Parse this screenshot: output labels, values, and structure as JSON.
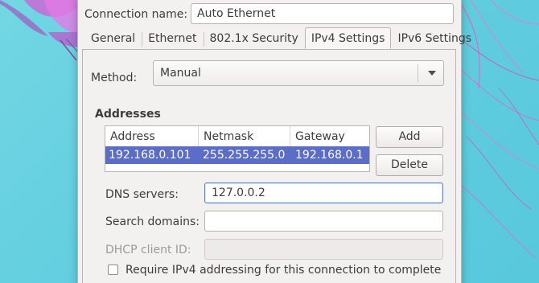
{
  "connection": {
    "label": "Connection name:",
    "value": "Auto Ethernet"
  },
  "tabs": [
    {
      "label": "General",
      "active": false
    },
    {
      "label": "Ethernet",
      "active": false
    },
    {
      "label": "802.1x Security",
      "active": false
    },
    {
      "label": "IPv4 Settings",
      "active": true
    },
    {
      "label": "IPv6 Settings",
      "active": false
    }
  ],
  "method": {
    "label": "Method:",
    "value": "Manual"
  },
  "addresses": {
    "title": "Addresses",
    "columns": [
      "Address",
      "Netmask",
      "Gateway"
    ],
    "rows": [
      [
        "192.168.0.101",
        "255.255.255.0",
        "192.168.0.1"
      ]
    ],
    "add_label": "Add",
    "delete_label": "Delete"
  },
  "dns": {
    "label": "DNS servers:",
    "value": "127.0.0.2"
  },
  "search_domains": {
    "label": "Search domains:",
    "value": ""
  },
  "dhcp_client_id": {
    "label": "DHCP client ID:",
    "value": ""
  },
  "require_ipv4": {
    "label": "Require IPv4 addressing for this connection to complete",
    "checked": false
  },
  "colors": {
    "selection": "#5b6dc7",
    "desktop": "#63cfe0"
  }
}
